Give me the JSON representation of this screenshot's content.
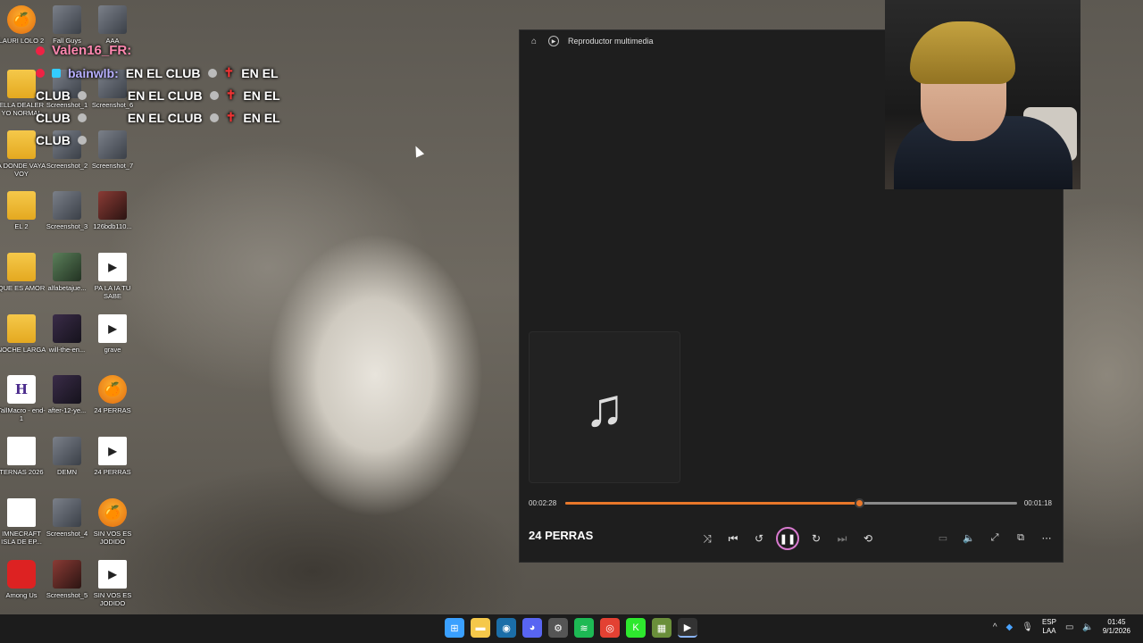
{
  "desktop": {
    "icons": [
      {
        "label": "LAURI LOLO 2",
        "type": "flstudio",
        "glyph": "🍊"
      },
      {
        "label": "Fall Guys",
        "type": "thumb",
        "glyph": ""
      },
      {
        "label": "AAA",
        "type": "thumb",
        "glyph": ""
      },
      {
        "label": "ELLA DEALER YO NORMAL",
        "type": "folder",
        "glyph": ""
      },
      {
        "label": "Screenshot_1",
        "type": "thumb",
        "glyph": ""
      },
      {
        "label": "Screenshot_6",
        "type": "thumb",
        "glyph": ""
      },
      {
        "label": "A DONDE VAYA VOY",
        "type": "folder",
        "glyph": ""
      },
      {
        "label": "Screenshot_2",
        "type": "thumb",
        "glyph": ""
      },
      {
        "label": "Screenshot_7",
        "type": "thumb",
        "glyph": ""
      },
      {
        "label": "EL 2",
        "type": "folder",
        "glyph": ""
      },
      {
        "label": "Screenshot_3",
        "type": "thumb",
        "glyph": ""
      },
      {
        "label": "126bdb110...",
        "type": "red",
        "glyph": ""
      },
      {
        "label": "QUE ES AMOR",
        "type": "folder",
        "glyph": ""
      },
      {
        "label": "alfabetajue...",
        "type": "green",
        "glyph": ""
      },
      {
        "label": "PA LA IA TU SABE",
        "type": "play",
        "glyph": "▶"
      },
      {
        "label": "NOCHE LARGA",
        "type": "folder",
        "glyph": ""
      },
      {
        "label": "will-the-en...",
        "type": "dark",
        "glyph": ""
      },
      {
        "label": "grave",
        "type": "play",
        "glyph": "▶"
      },
      {
        "label": "TallMacro - end-1",
        "type": "hcursor",
        "glyph": "H"
      },
      {
        "label": "after-12-ye...",
        "type": "dark",
        "glyph": ""
      },
      {
        "label": "24 PERRAS",
        "type": "flstudio",
        "glyph": "🍊"
      },
      {
        "label": "TERNAS 2026",
        "type": "file",
        "glyph": ""
      },
      {
        "label": "DEMN",
        "type": "thumb",
        "glyph": ""
      },
      {
        "label": "24 PERRAS",
        "type": "play",
        "glyph": "▶"
      },
      {
        "label": "IMNECRAFT ISLA DE EP...",
        "type": "file",
        "glyph": ""
      },
      {
        "label": "Screenshot_4",
        "type": "thumb",
        "glyph": ""
      },
      {
        "label": "SIN VOS ES JODIDO",
        "type": "flstudio",
        "glyph": "🍊"
      },
      {
        "label": "Among Us",
        "type": "amongus",
        "glyph": ""
      },
      {
        "label": "Screenshot_5",
        "type": "red",
        "glyph": ""
      },
      {
        "label": "SIN VOS ES JODIDO",
        "type": "play",
        "glyph": "▶"
      }
    ]
  },
  "chat": {
    "user1": "Valen16_FR:",
    "user2": "bainwlb:",
    "message": "EN EL CLUB",
    "fragment_a": "EN EL",
    "fragment_b": "CLUB"
  },
  "player": {
    "app_title": "Reproductor multimedia",
    "icons": {
      "home": "home-icon",
      "app": "play-circle-icon",
      "album": "music-note-icon"
    },
    "song_title": "24 PERRAS",
    "time_elapsed": "00:02:28",
    "time_remaining": "00:01:18",
    "progress_fraction": 0.65,
    "accent_color": "#e8772a",
    "pause_ring_color": "#d97ad0"
  },
  "taskbar": {
    "apps": [
      {
        "name": "windows-start",
        "glyph": "⊞",
        "color": "#3aa0ff"
      },
      {
        "name": "file-explorer",
        "glyph": "▬",
        "color": "#f5c84a"
      },
      {
        "name": "steam",
        "glyph": "◉",
        "color": "#1b6ea8"
      },
      {
        "name": "discord",
        "glyph": "◕",
        "color": "#5865f2"
      },
      {
        "name": "settings",
        "glyph": "⚙",
        "color": "#555"
      },
      {
        "name": "spotify",
        "glyph": "≋",
        "color": "#1db954"
      },
      {
        "name": "chrome",
        "glyph": "◎",
        "color": "#e34133"
      },
      {
        "name": "kick",
        "glyph": "K",
        "color": "#2ee82e"
      },
      {
        "name": "minecraft",
        "glyph": "▦",
        "color": "#6a8f3a"
      },
      {
        "name": "media-player",
        "glyph": "▶",
        "color": "#333"
      }
    ],
    "lang_top": "ESP",
    "lang_bottom": "LAA",
    "time": "01:45",
    "date": "9/1/2026"
  }
}
